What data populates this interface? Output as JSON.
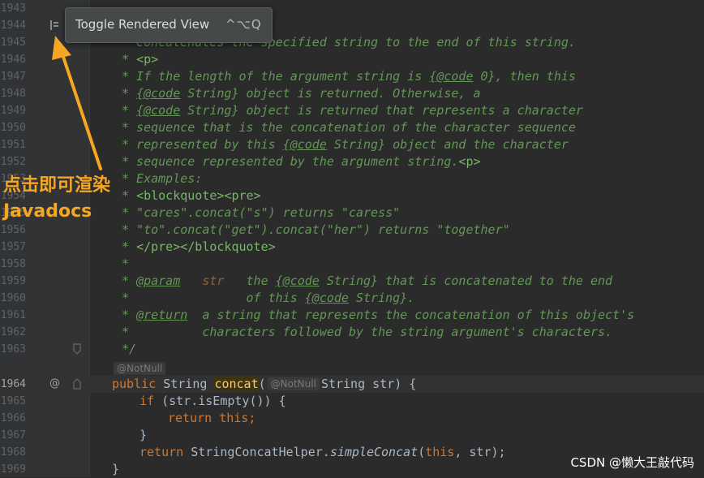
{
  "tooltip": {
    "label": "Toggle Rendered View",
    "shortcut": "^⌥Q"
  },
  "annotation": {
    "line1": "点击即可渲染",
    "line2": "Javadocs"
  },
  "watermark": "CSDN @懒大王敲代码",
  "gutter_icons": {
    "toggle": "render-toggle-icon",
    "override": "@"
  },
  "inlay": {
    "annotation": "@NotNull"
  },
  "lines": [
    {
      "n": "1943"
    },
    {
      "n": "1944"
    },
    {
      "n": "1945"
    },
    {
      "n": "1946"
    },
    {
      "n": "1947"
    },
    {
      "n": "1948"
    },
    {
      "n": "1949"
    },
    {
      "n": "1950"
    },
    {
      "n": "1951"
    },
    {
      "n": "1952"
    },
    {
      "n": "1953"
    },
    {
      "n": "1954"
    },
    {
      "n": "1955"
    },
    {
      "n": "1956"
    },
    {
      "n": "1957"
    },
    {
      "n": "1958"
    },
    {
      "n": "1959"
    },
    {
      "n": "1960"
    },
    {
      "n": "1961"
    },
    {
      "n": "1962"
    },
    {
      "n": "1963"
    },
    {
      "n": "1964"
    },
    {
      "n": "1965"
    },
    {
      "n": "1966"
    },
    {
      "n": "1967"
    },
    {
      "n": "1968"
    },
    {
      "n": "1969"
    }
  ],
  "code": {
    "l1945": "* Concatenates the specified string to the end of this string.",
    "l1946_a": "* ",
    "l1946_b": "<p>",
    "l1947_a": "* If the length of the argument string is ",
    "l1947_tag": "{@code",
    "l1947_b": " 0}, then this",
    "l1948_a": "* ",
    "l1948_tag": "{@code",
    "l1948_b": " String} object is returned. Otherwise, a",
    "l1949_a": "* ",
    "l1949_tag": "{@code",
    "l1949_b": " String} object is returned that represents a character",
    "l1950": "* sequence that is the concatenation of the character sequence",
    "l1951_a": "* represented by this ",
    "l1951_tag": "{@code",
    "l1951_b": " String} object and the character",
    "l1952_a": "* sequence represented by the argument string.",
    "l1952_b": "<p>",
    "l1953": "* Examples:",
    "l1954_a": "* ",
    "l1954_b": "<blockquote><pre>",
    "l1955": "* \"cares\".concat(\"s\") returns \"caress\"",
    "l1956": "* \"to\".concat(\"get\").concat(\"her\") returns \"together\"",
    "l1957_a": "* ",
    "l1957_b": "</pre></blockquote>",
    "l1958": "*",
    "l1959_a": "* ",
    "l1959_tag": "@param",
    "l1959_b": "   ",
    "l1959_p": "str",
    "l1959_c": "   the ",
    "l1959_tag2": "{@code",
    "l1959_d": " String} that is concatenated to the end",
    "l1960_a": "*                of this ",
    "l1960_tag": "{@code",
    "l1960_b": " String}.",
    "l1961_a": "* ",
    "l1961_tag": "@return",
    "l1961_b": "  a string that represents the concatenation of this object's",
    "l1962": "*          characters followed by the string argument's characters.",
    "l1963": "*/",
    "l1964_kw": "public",
    "l1964_a": " String ",
    "l1964_fn": "concat",
    "l1964_b": "(",
    "l1964_c": "String str) {",
    "l1965_kw": "if",
    "l1965_a": " (str.isEmpty()) {",
    "l1966_kw": "return this",
    "l1966_a": ";",
    "l1967": "}",
    "l1968_kw": "return",
    "l1968_a": " StringConcatHelper.",
    "l1968_fn": "simpleConcat",
    "l1968_b": "(",
    "l1968_kw2": "this",
    "l1968_c": ", str);",
    "l1969": "}"
  }
}
